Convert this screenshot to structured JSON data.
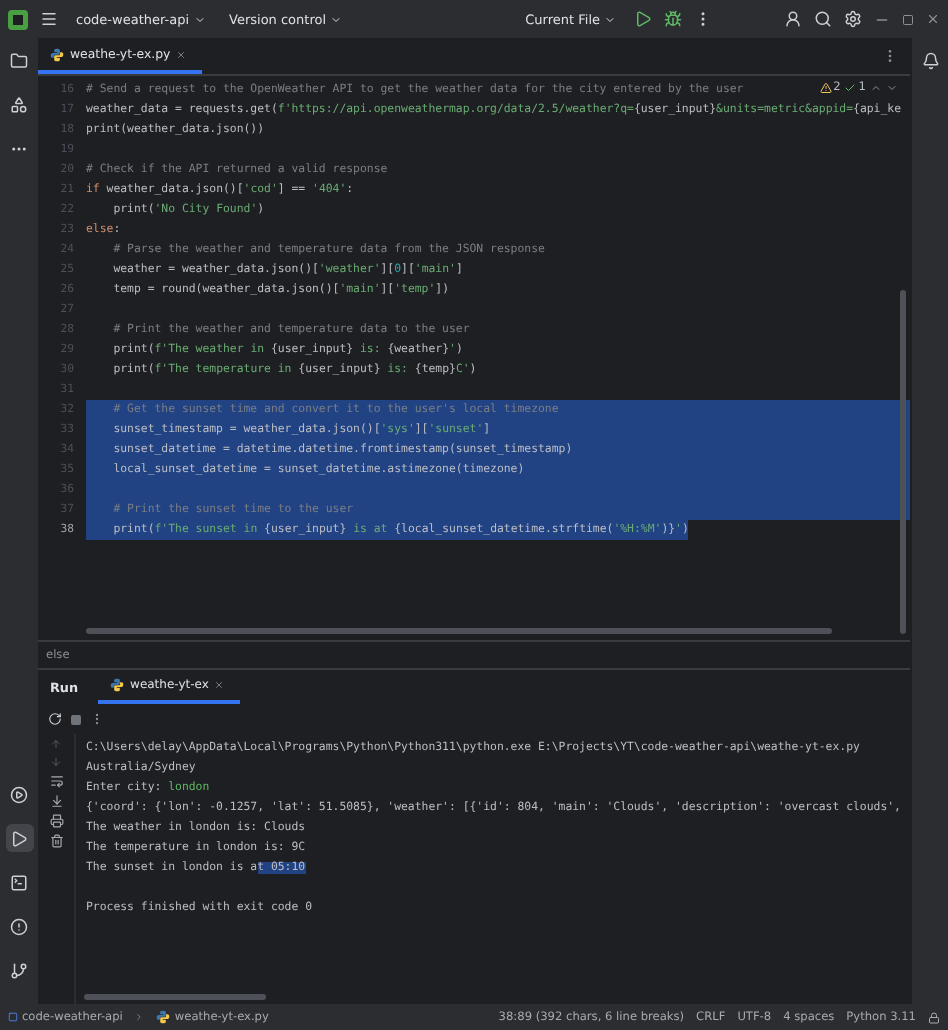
{
  "titlebar": {
    "project": "code-weather-api",
    "vcs": "Version control",
    "run_config": "Current File"
  },
  "editor_tabs": [
    {
      "label": "weathe-yt-ex.py",
      "selected": true
    }
  ],
  "inspections": {
    "warnings": "2",
    "checks": "1"
  },
  "code_lines": [
    {
      "number": "16",
      "selected": false,
      "current": false,
      "segs": [
        {
          "kind": "c",
          "text": "# Send a request to the OpenWeather API to get the weather data for the city entered by the user"
        }
      ]
    },
    {
      "number": "17",
      "selected": false,
      "current": false,
      "segs": [
        {
          "kind": "p",
          "text": "weather_data = requests.get("
        },
        {
          "kind": "s",
          "text": "f'https://api.openweathermap.org/data/2.5/weather?q="
        },
        {
          "kind": "p",
          "text": "{user_input}"
        },
        {
          "kind": "s",
          "text": "&units=metric&appid="
        },
        {
          "kind": "p",
          "text": "{api_ke"
        }
      ]
    },
    {
      "number": "18",
      "selected": false,
      "current": false,
      "segs": [
        {
          "kind": "p",
          "text": "print(weather_data.json())"
        }
      ]
    },
    {
      "number": "19",
      "selected": false,
      "current": false
    },
    {
      "number": "20",
      "selected": false,
      "current": false,
      "segs": [
        {
          "kind": "c",
          "text": "# Check if the API returned a valid response"
        }
      ]
    },
    {
      "number": "21",
      "selected": false,
      "current": false,
      "segs": [
        {
          "kind": "k",
          "text": "if"
        },
        {
          "kind": "p",
          "text": " weather_data.json()["
        },
        {
          "kind": "s",
          "text": "'cod'"
        },
        {
          "kind": "p",
          "text": "] == "
        },
        {
          "kind": "s",
          "text": "'404'"
        },
        {
          "kind": "p",
          "text": ":"
        }
      ]
    },
    {
      "number": "22",
      "selected": false,
      "current": false,
      "segs": [
        {
          "kind": "p",
          "text": "    print("
        },
        {
          "kind": "s",
          "text": "'No City Found'"
        },
        {
          "kind": "p",
          "text": ")"
        }
      ]
    },
    {
      "number": "23",
      "selected": false,
      "current": false,
      "segs": [
        {
          "kind": "k",
          "text": "else"
        },
        {
          "kind": "p",
          "text": ":"
        }
      ]
    },
    {
      "number": "24",
      "selected": false,
      "current": false,
      "segs": [
        {
          "kind": "c",
          "text": "    # Parse the weather and temperature data from the JSON response"
        }
      ]
    },
    {
      "number": "25",
      "selected": false,
      "current": false,
      "segs": [
        {
          "kind": "p",
          "text": "    weather = weather_data.json()["
        },
        {
          "kind": "s",
          "text": "'weather'"
        },
        {
          "kind": "p",
          "text": "]["
        },
        {
          "kind": "n",
          "text": "0"
        },
        {
          "kind": "p",
          "text": "]["
        },
        {
          "kind": "s",
          "text": "'main'"
        },
        {
          "kind": "p",
          "text": "]"
        }
      ]
    },
    {
      "number": "26",
      "selected": false,
      "current": false,
      "segs": [
        {
          "kind": "p",
          "text": "    temp = round(weather_data.json()["
        },
        {
          "kind": "s",
          "text": "'main'"
        },
        {
          "kind": "p",
          "text": "]["
        },
        {
          "kind": "s",
          "text": "'temp'"
        },
        {
          "kind": "p",
          "text": "])"
        }
      ]
    },
    {
      "number": "27",
      "selected": false,
      "current": false
    },
    {
      "number": "28",
      "selected": false,
      "current": false,
      "segs": [
        {
          "kind": "c",
          "text": "    # Print the weather and temperature data to the user"
        }
      ]
    },
    {
      "number": "29",
      "selected": false,
      "current": false,
      "segs": [
        {
          "kind": "p",
          "text": "    print("
        },
        {
          "kind": "s",
          "text": "f'The weather in "
        },
        {
          "kind": "p",
          "text": "{user_input}"
        },
        {
          "kind": "s",
          "text": " is: "
        },
        {
          "kind": "p",
          "text": "{weather}"
        },
        {
          "kind": "s",
          "text": "'"
        },
        {
          "kind": "p",
          "text": ")"
        }
      ]
    },
    {
      "number": "30",
      "selected": false,
      "current": false,
      "segs": [
        {
          "kind": "p",
          "text": "    print("
        },
        {
          "kind": "s",
          "text": "f'The temperature in "
        },
        {
          "kind": "p",
          "text": "{user_input}"
        },
        {
          "kind": "s",
          "text": " is: "
        },
        {
          "kind": "p",
          "text": "{temp}"
        },
        {
          "kind": "s",
          "text": "C'"
        },
        {
          "kind": "p",
          "text": ")"
        }
      ]
    },
    {
      "number": "31",
      "selected": false,
      "current": false
    },
    {
      "number": "32",
      "selected": true,
      "current": false,
      "segs": [
        {
          "kind": "c",
          "text": "    # Get the sunset time and convert it to the user's local timezone"
        }
      ]
    },
    {
      "number": "33",
      "selected": true,
      "current": false,
      "segs": [
        {
          "kind": "p",
          "text": "    sunset_timestamp = weather_data.json()["
        },
        {
          "kind": "s",
          "text": "'sys'"
        },
        {
          "kind": "p",
          "text": "]["
        },
        {
          "kind": "s",
          "text": "'sunset'"
        },
        {
          "kind": "p",
          "text": "]"
        }
      ]
    },
    {
      "number": "34",
      "selected": true,
      "current": false,
      "segs": [
        {
          "kind": "p",
          "text": "    sunset_datetime = datetime.datetime.fromtimestamp(sunset_timestamp)"
        }
      ]
    },
    {
      "number": "35",
      "selected": true,
      "current": false,
      "segs": [
        {
          "kind": "p",
          "text": "    local_sunset_datetime = sunset_datetime.astimezone(timezone)"
        }
      ]
    },
    {
      "number": "36",
      "selected": true,
      "current": false
    },
    {
      "number": "37",
      "selected": true,
      "current": false,
      "segs": [
        {
          "kind": "c",
          "text": "    # Print the sunset time to the user"
        }
      ]
    },
    {
      "number": "38",
      "selected": true,
      "current": true,
      "segs": [
        {
          "kind": "p",
          "text": "    print("
        },
        {
          "kind": "s",
          "text": "f'The sunset in "
        },
        {
          "kind": "p",
          "text": "{user_input}"
        },
        {
          "kind": "s",
          "text": " is at "
        },
        {
          "kind": "p",
          "text": "{local_sunset_datetime.strftime("
        },
        {
          "kind": "s",
          "text": "'%H:%M'"
        },
        {
          "kind": "p",
          "text": ")}"
        },
        {
          "kind": "s",
          "text": "'"
        },
        {
          "kind": "p",
          "text": ")"
        }
      ]
    }
  ],
  "breadcrumb": "else",
  "run_panel": {
    "title": "Run",
    "tabs": [
      {
        "label": "weathe-yt-ex",
        "selected": true
      }
    ]
  },
  "console_lines": [
    {
      "segs": [
        {
          "kind": "p",
          "text": "C:\\Users\\delay\\AppData\\Local\\Programs\\Python\\Python311\\python.exe E:\\Projects\\YT\\code-weather-api\\weathe-yt-ex.py"
        }
      ]
    },
    {
      "segs": [
        {
          "kind": "p",
          "text": "Australia/Sydney"
        }
      ]
    },
    {
      "segs": [
        {
          "kind": "p",
          "text": "Enter city: "
        },
        {
          "kind": "input",
          "text": "london"
        }
      ]
    },
    {
      "segs": [
        {
          "kind": "p",
          "text": "{'coord': {'lon': -0.1257, 'lat': 51.5085}, 'weather': [{'id': 804, 'main': 'Clouds', 'description': 'overcast clouds',"
        }
      ]
    },
    {
      "segs": [
        {
          "kind": "p",
          "text": "The weather in london is: Clouds"
        }
      ]
    },
    {
      "segs": [
        {
          "kind": "p",
          "text": "The temperature in london is: 9C"
        }
      ]
    },
    {
      "segs": [
        {
          "kind": "p",
          "text": "The sunset in london is a"
        },
        {
          "kind": "selected",
          "text": "t 05:10"
        }
      ]
    },
    {
      "kind": "exit",
      "segs": [
        {
          "kind": "p",
          "text": "Process finished with exit code 0"
        }
      ]
    }
  ],
  "left_tools": [
    {
      "kind": "services",
      "selected": false
    },
    {
      "kind": "run",
      "selected": true
    },
    {
      "kind": "terminal",
      "selected": false
    },
    {
      "kind": "problems",
      "selected": false
    },
    {
      "kind": "git",
      "selected": false
    }
  ],
  "status_bar": {
    "project": "code-weather-api",
    "file": "weathe-yt-ex.py",
    "position": "38:89 (392 chars, 6 line breaks)",
    "line_ending": "CRLF",
    "encoding": "UTF-8",
    "indent": "4 spaces",
    "interpreter": "Python 3.11"
  }
}
